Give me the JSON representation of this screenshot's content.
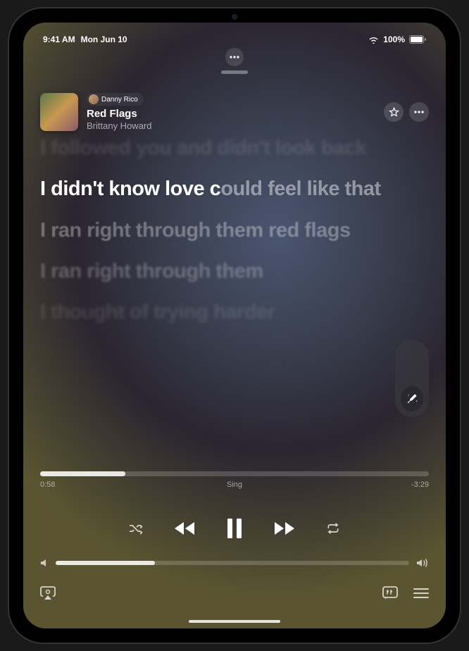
{
  "status": {
    "time": "9:41 AM",
    "date": "Mon Jun 10",
    "battery_pct": "100%"
  },
  "track": {
    "contributor": "Danny Rico",
    "title": "Red Flags",
    "artist": "Brittany Howard"
  },
  "lyrics": {
    "prev": "I followed you and didn't look back",
    "current_sung": "I didn't know love c",
    "current_unsung": "ould feel like that",
    "next1": "I ran right through them red flags",
    "next2": "I ran right through them",
    "next3": "I thought of trying harder"
  },
  "progress": {
    "elapsed": "0:58",
    "center_label": "Sing",
    "remaining": "-3:29"
  },
  "icons": {
    "more": "more",
    "star": "star",
    "shuffle": "shuffle",
    "rewind": "rewind",
    "pause": "pause",
    "forward": "forward",
    "repeat": "repeat",
    "airplay": "airplay",
    "lyrics": "lyrics",
    "queue": "queue",
    "mic": "mic"
  }
}
